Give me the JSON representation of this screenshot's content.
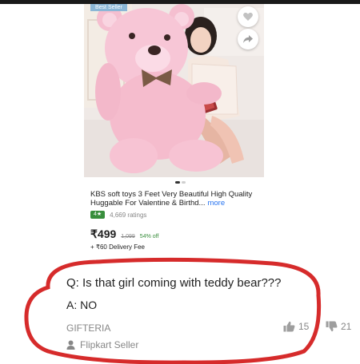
{
  "product": {
    "image_badge": "Best Seller",
    "title": "KBS soft toys 3 Feet Very Beautiful High Quality Huggable For Valentine & Birthd...",
    "more_link": "more",
    "rating": "4★",
    "ratings_count": "4,669 ratings",
    "price": "₹499",
    "mrp": "1,099",
    "discount": "54% off",
    "delivery_fee": "+ ₹60 Delivery Fee"
  },
  "qa": {
    "question": "Q: Is that girl coming with teddy bear???",
    "answer": "A: NO",
    "author": "GIFTERIA",
    "seller_label": "Flipkart Seller",
    "upvotes": "15",
    "downvotes": "21"
  },
  "colors": {
    "accent_blue": "#2874f0",
    "rating_green": "#388e3c",
    "annotation_red": "#d62b2b",
    "bear_pink": "#f6c3d3"
  },
  "icons": [
    "heart-icon",
    "share-icon",
    "thumbs-up-icon",
    "thumbs-down-icon",
    "seller-person-icon"
  ]
}
